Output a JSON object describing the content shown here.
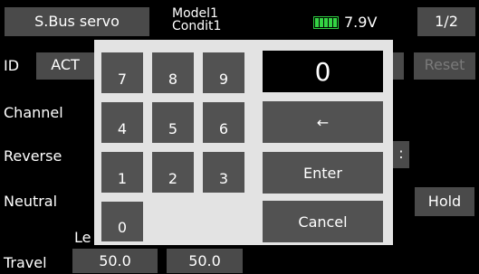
{
  "header": {
    "title_button": "S.Bus servo",
    "model_line1": "Model1",
    "model_line2": "Condit1",
    "battery_voltage": "7.9V",
    "page_indicator": "1/2"
  },
  "screen": {
    "id_label": "ID",
    "act_button": "ACT",
    "reset_button": "Reset",
    "channel_label": "Channel",
    "reverse_label": "Reverse",
    "reverse_fragment": ":",
    "neutral_label": "Neutral",
    "hold_button": "Hold",
    "left_fragment": "Le",
    "travel_label": "Travel",
    "travel_left": "50.0",
    "travel_right": "50.0"
  },
  "keypad": {
    "display_value": "0",
    "keys": [
      "7",
      "8",
      "9",
      "4",
      "5",
      "6",
      "1",
      "2",
      "3",
      "0"
    ],
    "backspace": "←",
    "enter": "Enter",
    "cancel": "Cancel"
  },
  "colors": {
    "battery_green": "#34d444",
    "button_gray": "#4a4a4a",
    "dialog_bg": "#e3e3e3"
  }
}
